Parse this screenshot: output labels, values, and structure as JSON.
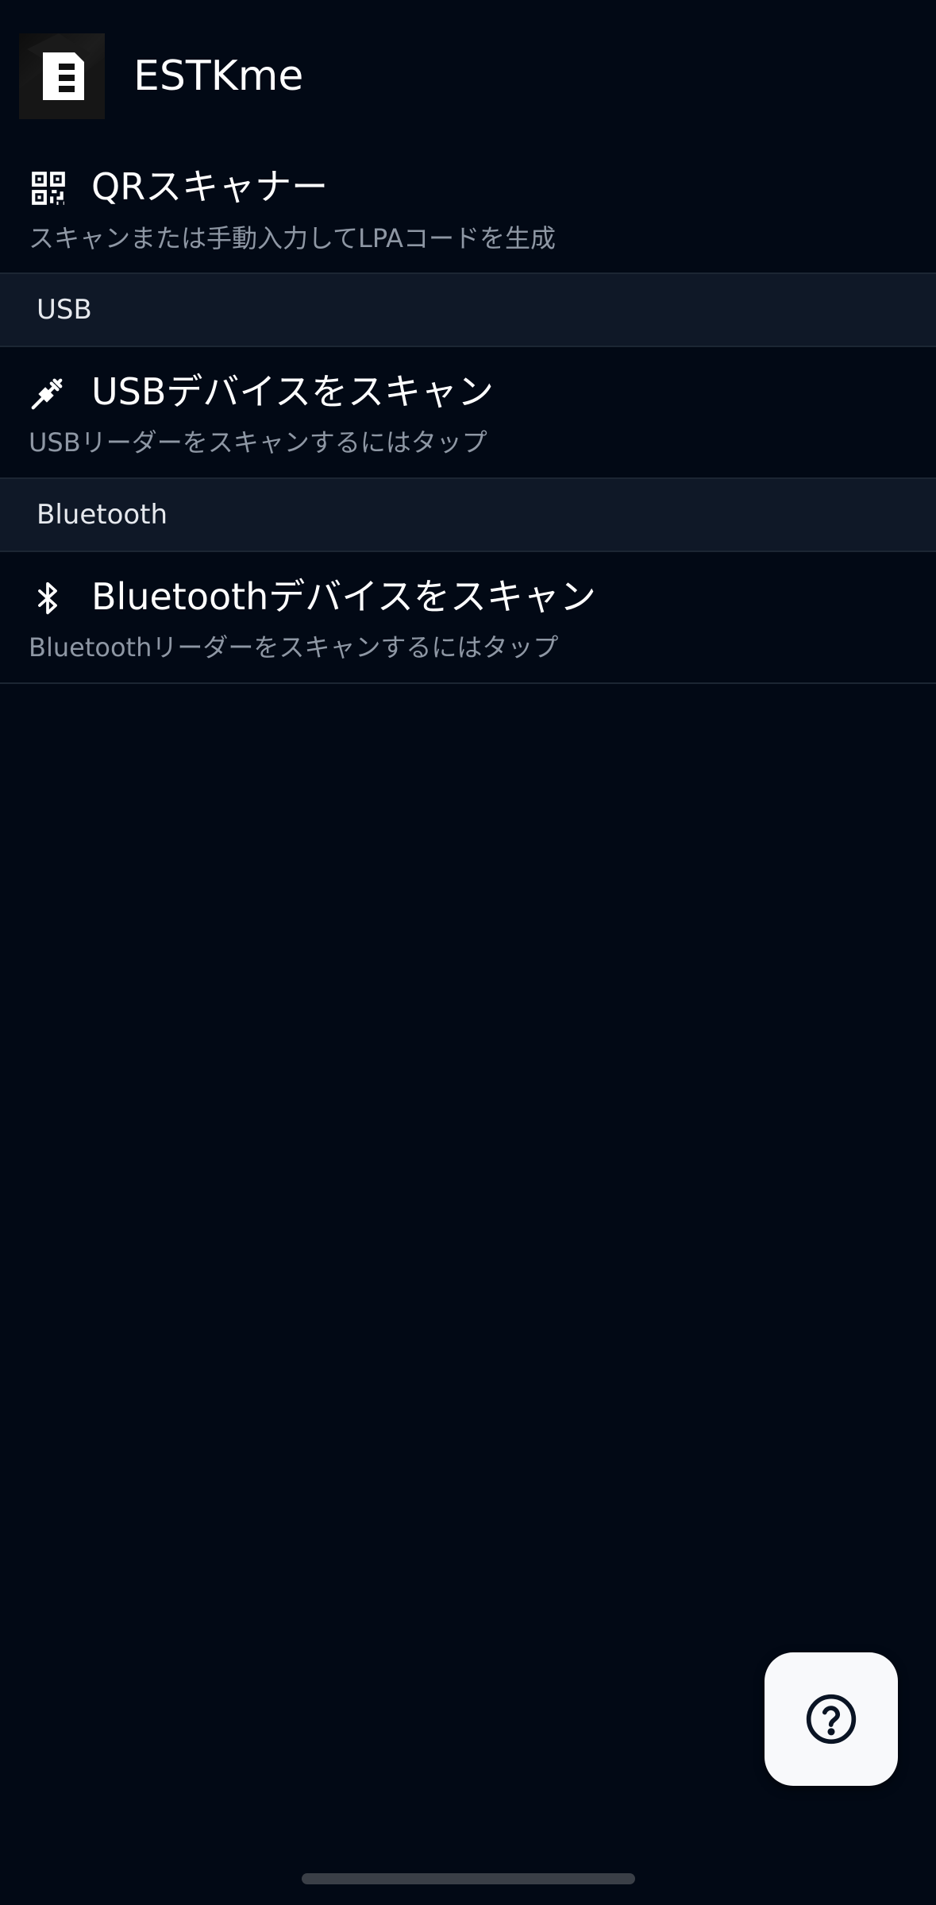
{
  "app_bar": {
    "title": "ESTKme",
    "logo_icon": "estkme-logo-icon"
  },
  "qr_scanner": {
    "icon": "qr-code-icon",
    "title": "QRスキャナー",
    "subtitle": "スキャンまたは手動入力してLPAコードを生成"
  },
  "sections": [
    {
      "header": "USB",
      "item": {
        "icon": "usb-icon",
        "title": "USBデバイスをスキャン",
        "subtitle": "USBリーダーをスキャンするにはタップ"
      }
    },
    {
      "header": "Bluetooth",
      "item": {
        "icon": "bluetooth-icon",
        "title": "Bluetoothデバイスをスキャン",
        "subtitle": "Bluetoothリーダーをスキャンするにはタップ"
      }
    }
  ],
  "fab": {
    "icon": "help-icon"
  },
  "colors": {
    "background": "#020915",
    "section_header_bg": "#0f1827",
    "divider": "#1c2633",
    "subtitle_text": "#8e97a4",
    "fab_bg": "#f8f9fb",
    "fab_icon": "#0a1424"
  }
}
